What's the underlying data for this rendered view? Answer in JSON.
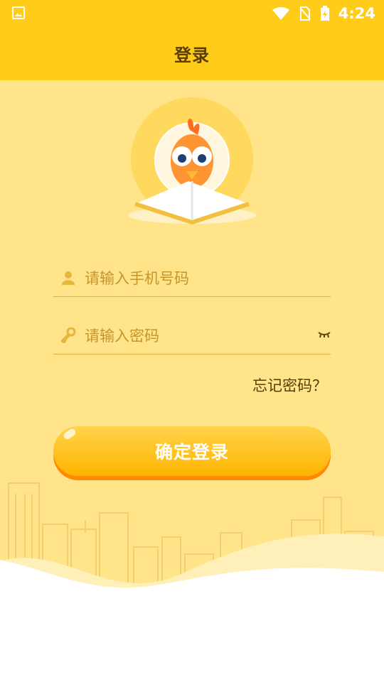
{
  "status": {
    "time": "4:24"
  },
  "header": {
    "title": "登录"
  },
  "form": {
    "phone_placeholder": "请输入手机号码",
    "password_placeholder": "请输入密码",
    "forgot_label": "忘记密码？",
    "submit_label": "确定登录"
  },
  "colors": {
    "status_bar": "#ffcc19",
    "background": "#ffe48a",
    "accent": "#ffb400",
    "label": "#5a3d00",
    "placeholder": "#c6962c"
  },
  "icons": [
    "image-icon",
    "wifi-icon",
    "no-sim-icon",
    "battery-charging-icon",
    "user-icon",
    "key-icon",
    "eye-closed-icon"
  ]
}
